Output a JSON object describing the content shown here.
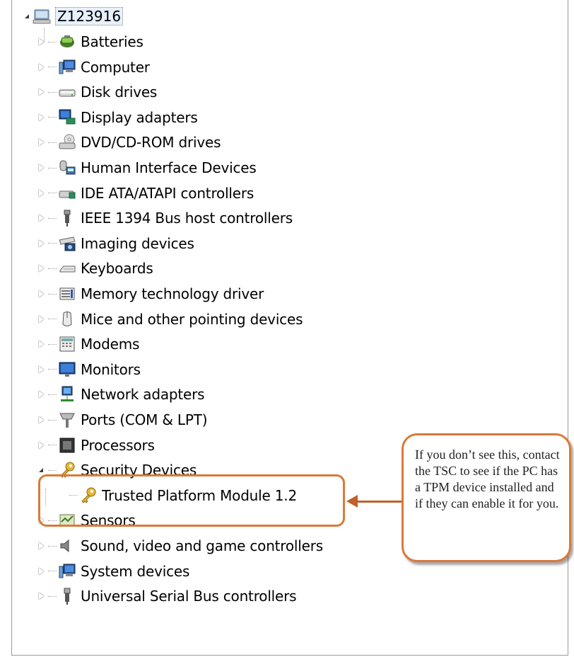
{
  "tree": {
    "root": {
      "label": "Z123916",
      "icon": "computer-root-icon"
    },
    "items": [
      {
        "label": "Batteries",
        "icon": "battery-icon",
        "state": "collapsed"
      },
      {
        "label": "Computer",
        "icon": "computer-icon",
        "state": "collapsed"
      },
      {
        "label": "Disk drives",
        "icon": "disk-drive-icon",
        "state": "collapsed"
      },
      {
        "label": "Display adapters",
        "icon": "display-adapter-icon",
        "state": "collapsed"
      },
      {
        "label": "DVD/CD-ROM drives",
        "icon": "dvd-drive-icon",
        "state": "collapsed"
      },
      {
        "label": "Human Interface Devices",
        "icon": "hid-icon",
        "state": "collapsed"
      },
      {
        "label": "IDE ATA/ATAPI controllers",
        "icon": "ide-controller-icon",
        "state": "collapsed"
      },
      {
        "label": "IEEE 1394 Bus host controllers",
        "icon": "ieee1394-icon",
        "state": "collapsed"
      },
      {
        "label": "Imaging devices",
        "icon": "camera-icon",
        "state": "collapsed"
      },
      {
        "label": "Keyboards",
        "icon": "keyboard-icon",
        "state": "collapsed"
      },
      {
        "label": "Memory technology driver",
        "icon": "memory-icon",
        "state": "collapsed"
      },
      {
        "label": "Mice and other pointing devices",
        "icon": "mouse-icon",
        "state": "collapsed"
      },
      {
        "label": "Modems",
        "icon": "modem-icon",
        "state": "collapsed"
      },
      {
        "label": "Monitors",
        "icon": "monitor-icon",
        "state": "collapsed"
      },
      {
        "label": "Network adapters",
        "icon": "network-icon",
        "state": "collapsed"
      },
      {
        "label": "Ports (COM & LPT)",
        "icon": "port-icon",
        "state": "collapsed"
      },
      {
        "label": "Processors",
        "icon": "processor-icon",
        "state": "collapsed"
      },
      {
        "label": "Security Devices",
        "icon": "key-icon",
        "state": "expanded"
      },
      {
        "label": "Trusted Platform Module 1.2",
        "icon": "key-icon",
        "state": "child"
      },
      {
        "label": "Sensors",
        "icon": "sensor-icon",
        "state": "collapsed"
      },
      {
        "label": "Sound, video and game controllers",
        "icon": "speaker-icon",
        "state": "collapsed"
      },
      {
        "label": "System devices",
        "icon": "system-device-icon",
        "state": "collapsed"
      },
      {
        "label": "Universal Serial Bus controllers",
        "icon": "usb-icon",
        "state": "collapsed"
      }
    ]
  },
  "callout": {
    "text": "If you don’t see this, contact the TSC to see if the PC has a TPM device installed and if they can enable it for you."
  },
  "colors": {
    "annotation": "#d97a3a",
    "arrow": "#c0602a",
    "selection": "#e8f1fb"
  }
}
